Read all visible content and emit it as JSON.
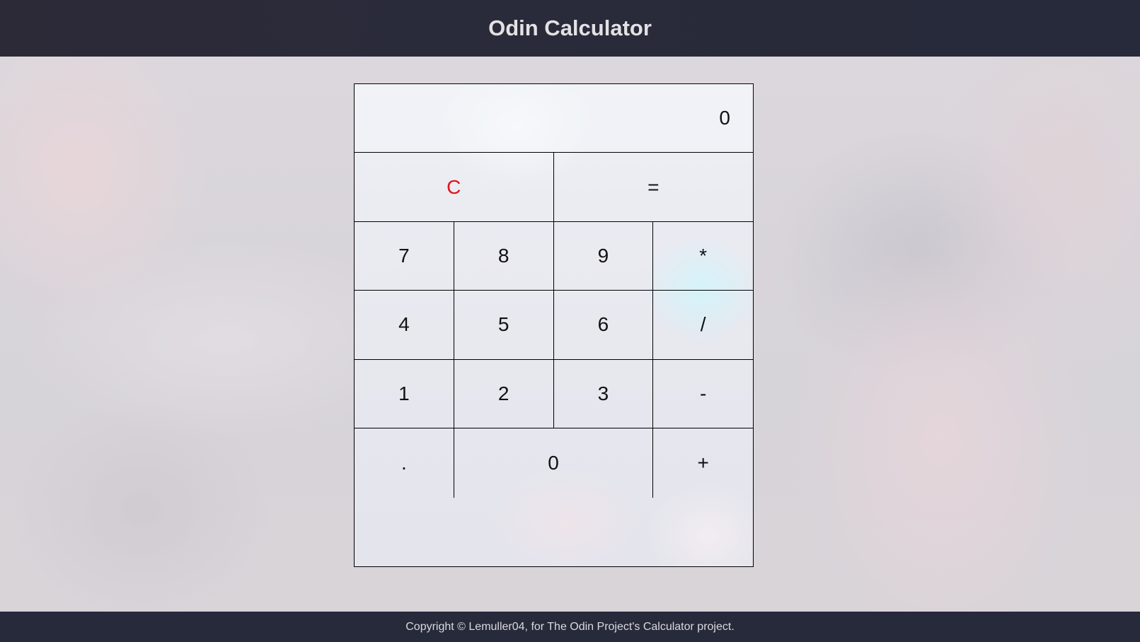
{
  "header": {
    "title": "Odin Calculator"
  },
  "display": {
    "value": "0"
  },
  "keys": {
    "clear": "C",
    "equals": "=",
    "seven": "7",
    "eight": "8",
    "nine": "9",
    "multiply": "*",
    "four": "4",
    "five": "5",
    "six": "6",
    "divide": "/",
    "one": "1",
    "two": "2",
    "three": "3",
    "subtract": "-",
    "decimal": ".",
    "zero": "0",
    "add": "+"
  },
  "colors": {
    "clear_key": "#e0121a",
    "header_bg": "#2a2b3a",
    "footer_bg": "#262a3b"
  },
  "footer": {
    "text": "Copyright © Lemuller04, for The Odin Project's Calculator project."
  }
}
